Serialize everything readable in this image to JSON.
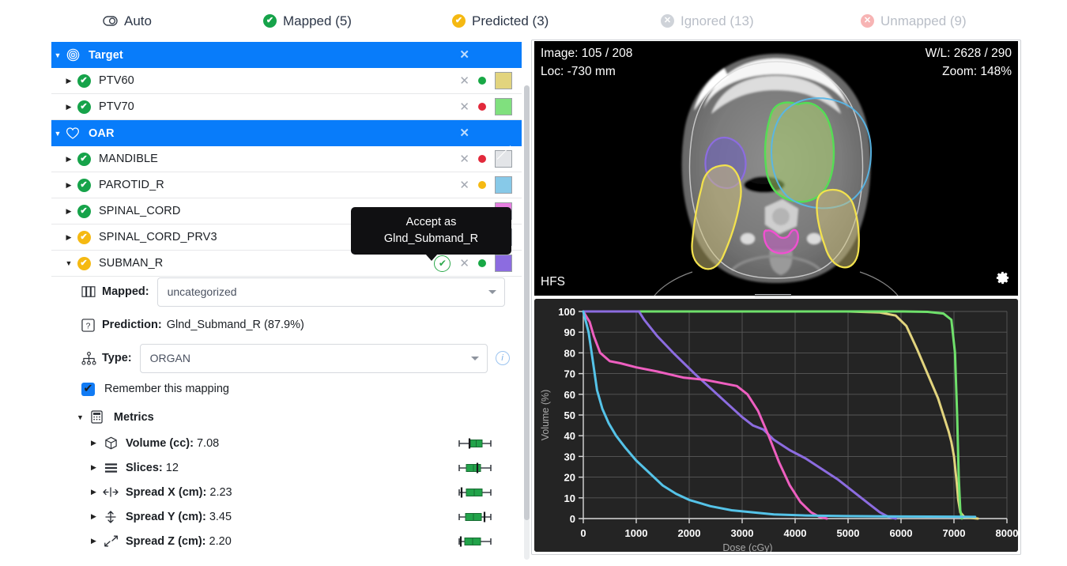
{
  "tabs": [
    {
      "label": "Auto",
      "icon": "auto-toggle-icon",
      "state": "normal"
    },
    {
      "label": "Mapped (5)",
      "icon": "check-circle-icon",
      "state": "green"
    },
    {
      "label": "Predicted (3)",
      "icon": "check-circle-icon",
      "state": "amber"
    },
    {
      "label": "Ignored (13)",
      "icon": "x-circle-icon",
      "state": "grey"
    },
    {
      "label": "Unmapped (9)",
      "icon": "x-circle-icon",
      "state": "rose"
    }
  ],
  "tree": [
    {
      "label": "Target",
      "type": "group",
      "icon": "target-icon",
      "expanded": true
    },
    {
      "label": "PTV60",
      "type": "item",
      "status": "green",
      "dot": "#18a845",
      "swatch": "#e2d47e"
    },
    {
      "label": "PTV70",
      "type": "item",
      "status": "green",
      "dot": "#e2293b",
      "swatch": "#80e07e"
    },
    {
      "label": "OAR",
      "type": "group",
      "icon": "heart-icon",
      "expanded": true
    },
    {
      "label": "MANDIBLE",
      "type": "item",
      "status": "green",
      "dot": "#e2293b",
      "swatch": "none"
    },
    {
      "label": "PAROTID_R",
      "type": "item",
      "status": "green",
      "dot": "#f5b912",
      "swatch": "#87c9e8"
    },
    {
      "label": "SPINAL_CORD",
      "type": "item",
      "status": "green",
      "dot": "#e2293b",
      "swatch": "#e67fe0"
    },
    {
      "label": "SPINAL_CORD_PRV3",
      "type": "item",
      "status": "amber",
      "dot": "#e2293b",
      "swatch": "none"
    },
    {
      "label": "SUBMAN_R",
      "type": "item",
      "status": "amber",
      "dot": "#18a845",
      "swatch": "#8c6ce0",
      "selected": true,
      "expanded": true,
      "accept": true
    }
  ],
  "tooltip": {
    "line1": "Accept as",
    "line2": "Glnd_Submand_R"
  },
  "detail": {
    "mapped_label": "Mapped:",
    "mapped_value": "uncategorized",
    "mapped_icon": "columns-icon",
    "prediction_label": "Prediction:",
    "prediction_value": "Glnd_Submand_R (87.9%)",
    "prediction_icon": "question-box-icon",
    "type_label": "Type:",
    "type_value": "ORGAN",
    "type_icon": "hierarchy-icon",
    "remember_label": "Remember this mapping",
    "remember_checked": true,
    "metrics_title": "Metrics",
    "metrics_icon": "calculator-icon",
    "metrics": [
      {
        "label": "Volume (cc):",
        "value": "7.08",
        "icon": "cube-icon",
        "marker": 0.42,
        "q1": 0.44,
        "q3": 0.74,
        "lo": 0.06,
        "hi": 0.96
      },
      {
        "label": "Slices:",
        "value": "12",
        "icon": "layers-icon",
        "marker": 0.62,
        "q1": 0.3,
        "q3": 0.72,
        "lo": 0.06,
        "hi": 0.96
      },
      {
        "label": "Spread X (cm):",
        "value": "2.23",
        "icon": "arrows-horizontal-icon",
        "marker": 0.12,
        "q1": 0.3,
        "q3": 0.78,
        "lo": 0.06,
        "hi": 0.96
      },
      {
        "label": "Spread Y (cm):",
        "value": "3.45",
        "icon": "arrows-vertical-icon",
        "marker": 0.86,
        "q1": 0.26,
        "q3": 0.78,
        "lo": 0.06,
        "hi": 0.96
      },
      {
        "label": "Spread Z (cm):",
        "value": "2.20",
        "icon": "arrows-diagonal-icon",
        "marker": 0.1,
        "q1": 0.22,
        "q3": 0.72,
        "lo": 0.04,
        "hi": 0.96
      }
    ]
  },
  "ct": {
    "image_label": "Image: 105 / 208",
    "loc_label": "Loc: -730 mm",
    "wl_label": "W/L: 2628 / 290",
    "zoom_label": "Zoom: 148%",
    "orientation": "HFS",
    "gear_icon": "gear-icon"
  },
  "chart_data": {
    "type": "line",
    "title": "",
    "xlabel": "Dose (cGy)",
    "ylabel": "Volume (%)",
    "xlim": [
      0,
      8000
    ],
    "ylim": [
      0,
      100
    ],
    "xticks": [
      0,
      1000,
      2000,
      3000,
      4000,
      5000,
      6000,
      7000,
      8000
    ],
    "yticks": [
      0,
      10,
      20,
      30,
      40,
      50,
      60,
      70,
      80,
      90,
      100
    ],
    "grid": true,
    "legend": "none",
    "background": "#242424",
    "series": [
      {
        "name": "PTV60",
        "color": "#e2d47e",
        "x": [
          0,
          600,
          1100,
          2000,
          3000,
          4000,
          5000,
          5600,
          5900,
          6100,
          6300,
          6500,
          6700,
          6800,
          6900,
          6950,
          7000,
          7050,
          7080,
          7120,
          7200,
          7450
        ],
        "values": [
          100,
          100,
          100,
          100,
          100,
          100,
          100,
          99.5,
          98,
          93,
          82,
          70,
          58,
          50,
          42,
          37,
          30,
          18,
          9,
          3,
          0.6,
          0
        ]
      },
      {
        "name": "PTV70",
        "color": "#6fe06b",
        "x": [
          0,
          1000,
          2000,
          3000,
          4000,
          5000,
          6000,
          6500,
          6800,
          6950,
          7020,
          7060,
          7090,
          7120,
          7150
        ],
        "values": [
          100,
          100,
          100,
          100,
          100,
          100,
          100,
          99.8,
          99,
          96,
          80,
          50,
          20,
          4,
          0
        ]
      },
      {
        "name": "MANDIBLE",
        "color": "#8c6ce0",
        "x": [
          0,
          200,
          600,
          1050,
          1150,
          1400,
          1700,
          1900,
          2100,
          2400,
          2700,
          3000,
          3200,
          3400,
          3600,
          3900,
          4200,
          4500,
          4800,
          5100,
          5400,
          5600,
          5750,
          5900
        ],
        "values": [
          100,
          100,
          100,
          100,
          96,
          88,
          80,
          75,
          70,
          63,
          56,
          49,
          45,
          43,
          38,
          33,
          29,
          24,
          19,
          13,
          7,
          3,
          1,
          0
        ]
      },
      {
        "name": "SPINAL_CORD",
        "color": "#ee5fc0",
        "x": [
          0,
          120,
          200,
          320,
          500,
          700,
          1000,
          1400,
          1900,
          2300,
          2700,
          2900,
          3100,
          3300,
          3500,
          3700,
          3900,
          4100,
          4300,
          4450,
          4600
        ],
        "values": [
          100,
          95,
          88,
          80,
          76,
          75,
          73,
          71,
          68,
          67,
          65,
          64,
          60,
          52,
          40,
          27,
          16,
          8,
          3,
          1,
          0
        ]
      },
      {
        "name": "PAROTID_R",
        "color": "#55c3e8",
        "x": [
          0,
          100,
          180,
          260,
          360,
          480,
          620,
          800,
          1000,
          1250,
          1500,
          1750,
          2000,
          2400,
          2800,
          3200,
          3600,
          4200,
          5000,
          6000,
          7000,
          7400
        ],
        "values": [
          100,
          90,
          76,
          62,
          53,
          46,
          40,
          34,
          28,
          22,
          16,
          12,
          9,
          6,
          4,
          3,
          2,
          1.5,
          1.2,
          1,
          0.9,
          0.8
        ]
      }
    ]
  }
}
